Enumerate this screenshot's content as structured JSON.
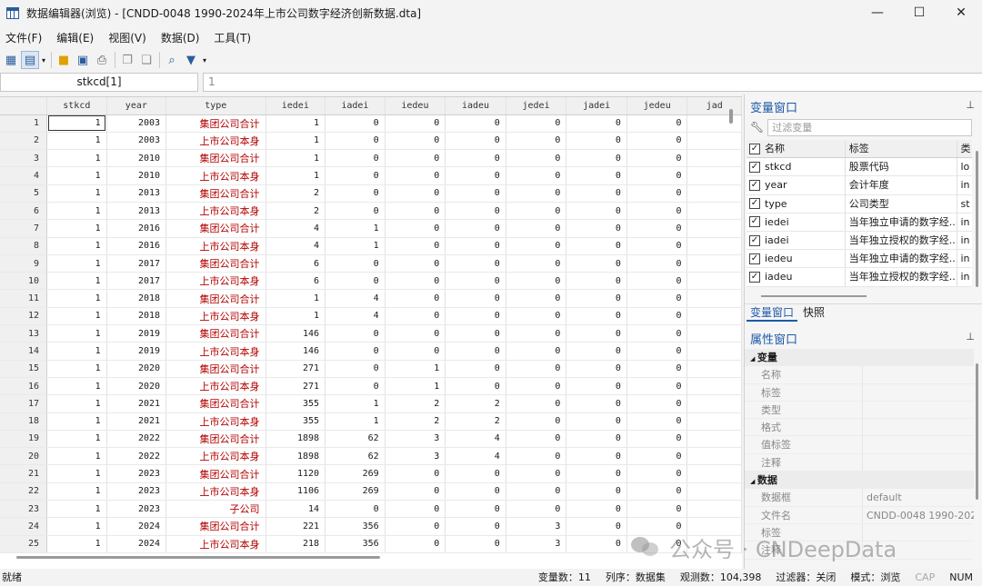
{
  "window": {
    "title": "数据编辑器(浏览) - [CNDD-0048 1990-2024年上市公司数字经济创新数据.dta]",
    "minimize": "—",
    "maximize": "☐",
    "close": "✕"
  },
  "menu": [
    "文件(F)",
    "编辑(E)",
    "视图(V)",
    "数据(D)",
    "工具(T)"
  ],
  "cellbar": {
    "name": "stkcd[1]",
    "value": "1"
  },
  "grid": {
    "columns": [
      "stkcd",
      "year",
      "type",
      "iedei",
      "iadei",
      "iedeu",
      "iadeu",
      "jedei",
      "jadei",
      "jedeu",
      "jad"
    ],
    "rows": [
      [
        "1",
        "1",
        "2003",
        "集团公司合计",
        "1",
        "0",
        "0",
        "0",
        "0",
        "0",
        "0"
      ],
      [
        "2",
        "1",
        "2003",
        "上市公司本身",
        "1",
        "0",
        "0",
        "0",
        "0",
        "0",
        "0"
      ],
      [
        "3",
        "1",
        "2010",
        "集团公司合计",
        "1",
        "0",
        "0",
        "0",
        "0",
        "0",
        "0"
      ],
      [
        "4",
        "1",
        "2010",
        "上市公司本身",
        "1",
        "0",
        "0",
        "0",
        "0",
        "0",
        "0"
      ],
      [
        "5",
        "1",
        "2013",
        "集团公司合计",
        "2",
        "0",
        "0",
        "0",
        "0",
        "0",
        "0"
      ],
      [
        "6",
        "1",
        "2013",
        "上市公司本身",
        "2",
        "0",
        "0",
        "0",
        "0",
        "0",
        "0"
      ],
      [
        "7",
        "1",
        "2016",
        "集团公司合计",
        "4",
        "1",
        "0",
        "0",
        "0",
        "0",
        "0"
      ],
      [
        "8",
        "1",
        "2016",
        "上市公司本身",
        "4",
        "1",
        "0",
        "0",
        "0",
        "0",
        "0"
      ],
      [
        "9",
        "1",
        "2017",
        "集团公司合计",
        "6",
        "0",
        "0",
        "0",
        "0",
        "0",
        "0"
      ],
      [
        "10",
        "1",
        "2017",
        "上市公司本身",
        "6",
        "0",
        "0",
        "0",
        "0",
        "0",
        "0"
      ],
      [
        "11",
        "1",
        "2018",
        "集团公司合计",
        "1",
        "4",
        "0",
        "0",
        "0",
        "0",
        "0"
      ],
      [
        "12",
        "1",
        "2018",
        "上市公司本身",
        "1",
        "4",
        "0",
        "0",
        "0",
        "0",
        "0"
      ],
      [
        "13",
        "1",
        "2019",
        "集团公司合计",
        "146",
        "0",
        "0",
        "0",
        "0",
        "0",
        "0"
      ],
      [
        "14",
        "1",
        "2019",
        "上市公司本身",
        "146",
        "0",
        "0",
        "0",
        "0",
        "0",
        "0"
      ],
      [
        "15",
        "1",
        "2020",
        "集团公司合计",
        "271",
        "0",
        "1",
        "0",
        "0",
        "0",
        "0"
      ],
      [
        "16",
        "1",
        "2020",
        "上市公司本身",
        "271",
        "0",
        "1",
        "0",
        "0",
        "0",
        "0"
      ],
      [
        "17",
        "1",
        "2021",
        "集团公司合计",
        "355",
        "1",
        "2",
        "2",
        "0",
        "0",
        "0"
      ],
      [
        "18",
        "1",
        "2021",
        "上市公司本身",
        "355",
        "1",
        "2",
        "2",
        "0",
        "0",
        "0"
      ],
      [
        "19",
        "1",
        "2022",
        "集团公司合计",
        "1898",
        "62",
        "3",
        "4",
        "0",
        "0",
        "0"
      ],
      [
        "20",
        "1",
        "2022",
        "上市公司本身",
        "1898",
        "62",
        "3",
        "4",
        "0",
        "0",
        "0"
      ],
      [
        "21",
        "1",
        "2023",
        "集团公司合计",
        "1120",
        "269",
        "0",
        "0",
        "0",
        "0",
        "0"
      ],
      [
        "22",
        "1",
        "2023",
        "上市公司本身",
        "1106",
        "269",
        "0",
        "0",
        "0",
        "0",
        "0"
      ],
      [
        "23",
        "1",
        "2023",
        "子公司",
        "14",
        "0",
        "0",
        "0",
        "0",
        "0",
        "0"
      ],
      [
        "24",
        "1",
        "2024",
        "集团公司合计",
        "221",
        "356",
        "0",
        "0",
        "3",
        "0",
        "0"
      ],
      [
        "25",
        "1",
        "2024",
        "上市公司本身",
        "218",
        "356",
        "0",
        "0",
        "3",
        "0",
        "0"
      ]
    ]
  },
  "variables_panel": {
    "title": "变量窗口",
    "pin": "📌",
    "filter_placeholder": "过滤变量",
    "headers": {
      "name": "名称",
      "label": "标签",
      "type": "类"
    },
    "items": [
      {
        "name": "stkcd",
        "label": "股票代码",
        "type": "lo"
      },
      {
        "name": "year",
        "label": "会计年度",
        "type": "in"
      },
      {
        "name": "type",
        "label": "公司类型",
        "type": "st"
      },
      {
        "name": "iedei",
        "label": "当年独立申请的数字经...",
        "type": "in"
      },
      {
        "name": "iadei",
        "label": "当年独立授权的数字经...",
        "type": "in"
      },
      {
        "name": "iedeu",
        "label": "当年独立申请的数字经...",
        "type": "in"
      },
      {
        "name": "iadeu",
        "label": "当年独立授权的数字经...",
        "type": "in"
      }
    ],
    "tabs": [
      "变量窗口",
      "快照"
    ]
  },
  "properties_panel": {
    "title": "属性窗口",
    "sections": [
      {
        "name": "变量",
        "rows": [
          {
            "k": "名称",
            "v": ""
          },
          {
            "k": "标签",
            "v": ""
          },
          {
            "k": "类型",
            "v": ""
          },
          {
            "k": "格式",
            "v": ""
          },
          {
            "k": "值标签",
            "v": ""
          },
          {
            "k": "注释",
            "v": ""
          }
        ]
      },
      {
        "name": "数据",
        "rows": [
          {
            "k": "数据框",
            "v": "default"
          },
          {
            "k": "文件名",
            "v": "CNDD-0048 1990-202"
          },
          {
            "k": "标签",
            "v": ""
          },
          {
            "k": "注释",
            "v": ""
          }
        ]
      }
    ]
  },
  "statusbar": {
    "left": "就绪",
    "vars": "变量数：11",
    "order": "列序：数据集",
    "obs": "观测数：104,398",
    "filter": "过滤器：关闭",
    "mode": "模式：浏览",
    "cap": "CAP",
    "num": "NUM"
  },
  "watermark": "公众号 · CNDeepData",
  "colors": {
    "accent": "#1e5aa8",
    "string_value": "#b30000"
  }
}
